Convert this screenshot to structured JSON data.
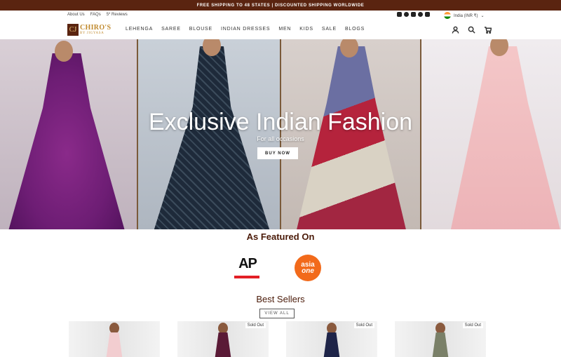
{
  "announcement": "FREE SHIPPING TO 48 STATES | DISCOUNTED SHIPPING WORLDWIDE",
  "utility_links": [
    "About Us",
    "FAQs",
    "5* Reviews"
  ],
  "country_selector": "India (INR ₹)",
  "logo": {
    "mark": "CJ",
    "main": "CHIRO'S",
    "sub": "BY JIGYASA"
  },
  "nav": [
    "LEHENGA",
    "SAREE",
    "BLOUSE",
    "INDIAN DRESSES",
    "MEN",
    "KIDS",
    "SALE",
    "BLOGS"
  ],
  "icons": [
    "instagram-icon",
    "facebook-icon",
    "twitter-icon",
    "pinterest-icon",
    "tiktok-icon",
    "account-icon",
    "search-icon",
    "cart-icon"
  ],
  "hero": {
    "title": "Exclusive Indian Fashion",
    "subtitle": "For all occasions",
    "button": "BUY NOW"
  },
  "featured": {
    "title": "As Featured On",
    "ap": "AP",
    "asia_top": "asia",
    "asia_bottom": "one"
  },
  "best_sellers": {
    "title": "Best Sellers",
    "view_all": "VIEW ALL",
    "products": [
      {
        "badge": ""
      },
      {
        "badge": "Sold Out"
      },
      {
        "badge": "Sold Out"
      },
      {
        "badge": "Sold Out"
      }
    ]
  },
  "colors": {
    "accent": "#5a2410",
    "heading": "#4a1a08",
    "logo_gold": "#c08a2e",
    "ap_red": "#e21f26",
    "asiaone_orange": "#f26a1b"
  }
}
